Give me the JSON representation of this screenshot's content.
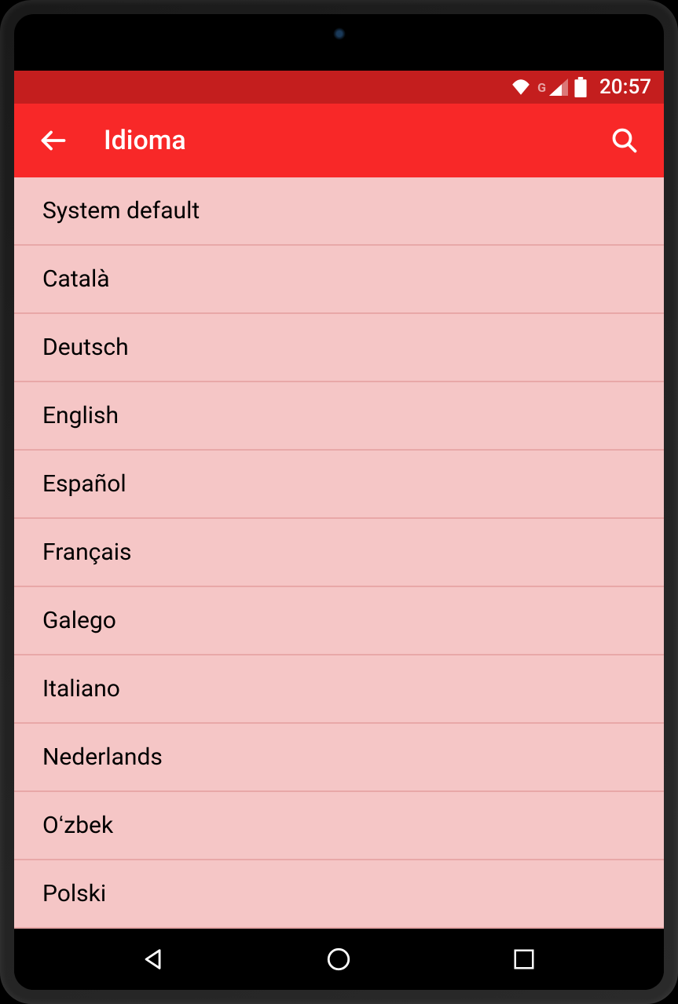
{
  "status_bar": {
    "time": "20:57",
    "network_label": "G"
  },
  "app_bar": {
    "title": "Idioma"
  },
  "languages": [
    "System default",
    "Català",
    "Deutsch",
    "English",
    "Español",
    "Français",
    "Galego",
    "Italiano",
    "Nederlands",
    "Oʻzbek",
    "Polski"
  ]
}
